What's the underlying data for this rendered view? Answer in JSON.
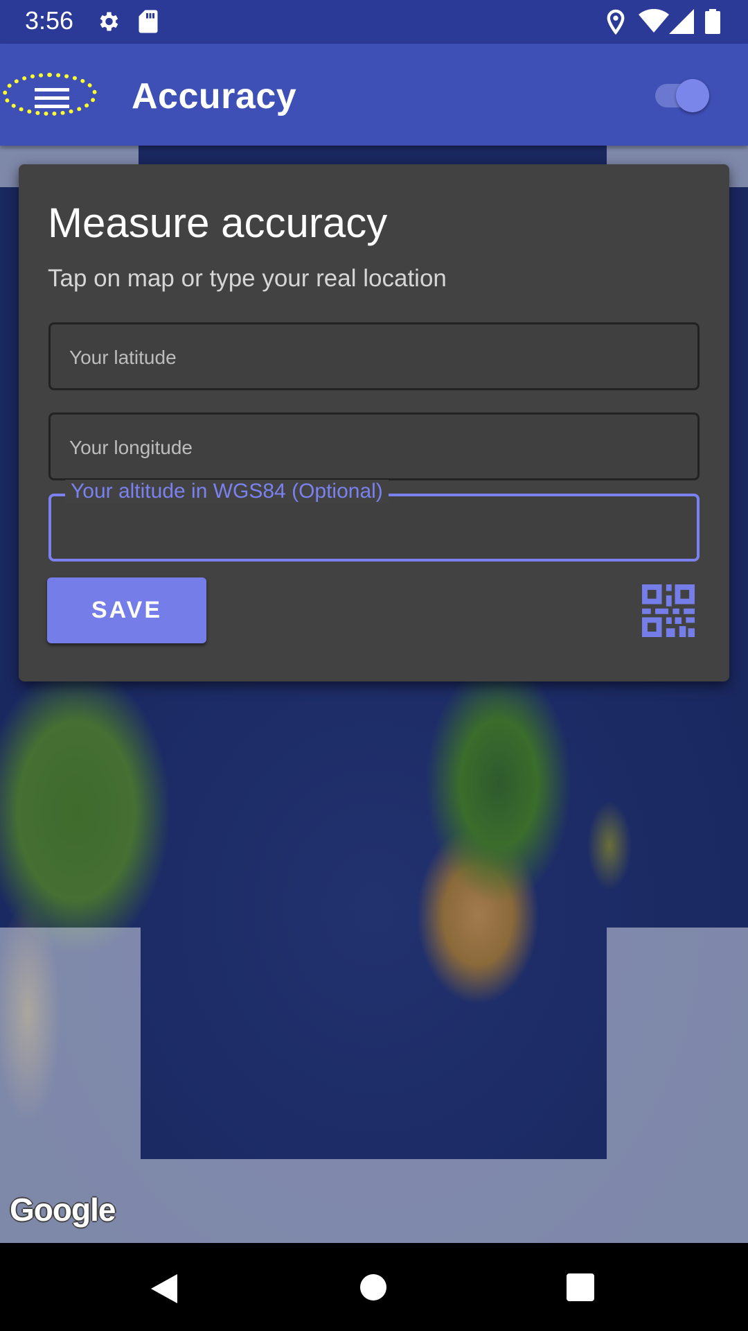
{
  "status_bar": {
    "time": "3:56",
    "icons": [
      "settings-icon",
      "sd-card-icon",
      "location-icon",
      "wifi-icon",
      "signal-icon",
      "battery-icon"
    ]
  },
  "app_bar": {
    "title": "Accuracy",
    "menu_icon": "hamburger-menu-icon",
    "toggle_on": true,
    "color": "#3e4fb5"
  },
  "dialog": {
    "title": "Measure accuracy",
    "subtitle": "Tap on map or type your real location",
    "latitude_placeholder": "Your latitude",
    "longitude_placeholder": "Your longitude",
    "altitude_label": "Your altitude in WGS84 (Optional)",
    "save_label": "SAVE",
    "qr_icon": "qr-code-icon",
    "accent": "#747de8"
  },
  "map": {
    "attribution": "Google"
  },
  "nav_bar": {
    "icons": [
      "back-icon",
      "home-icon",
      "recents-icon"
    ]
  }
}
